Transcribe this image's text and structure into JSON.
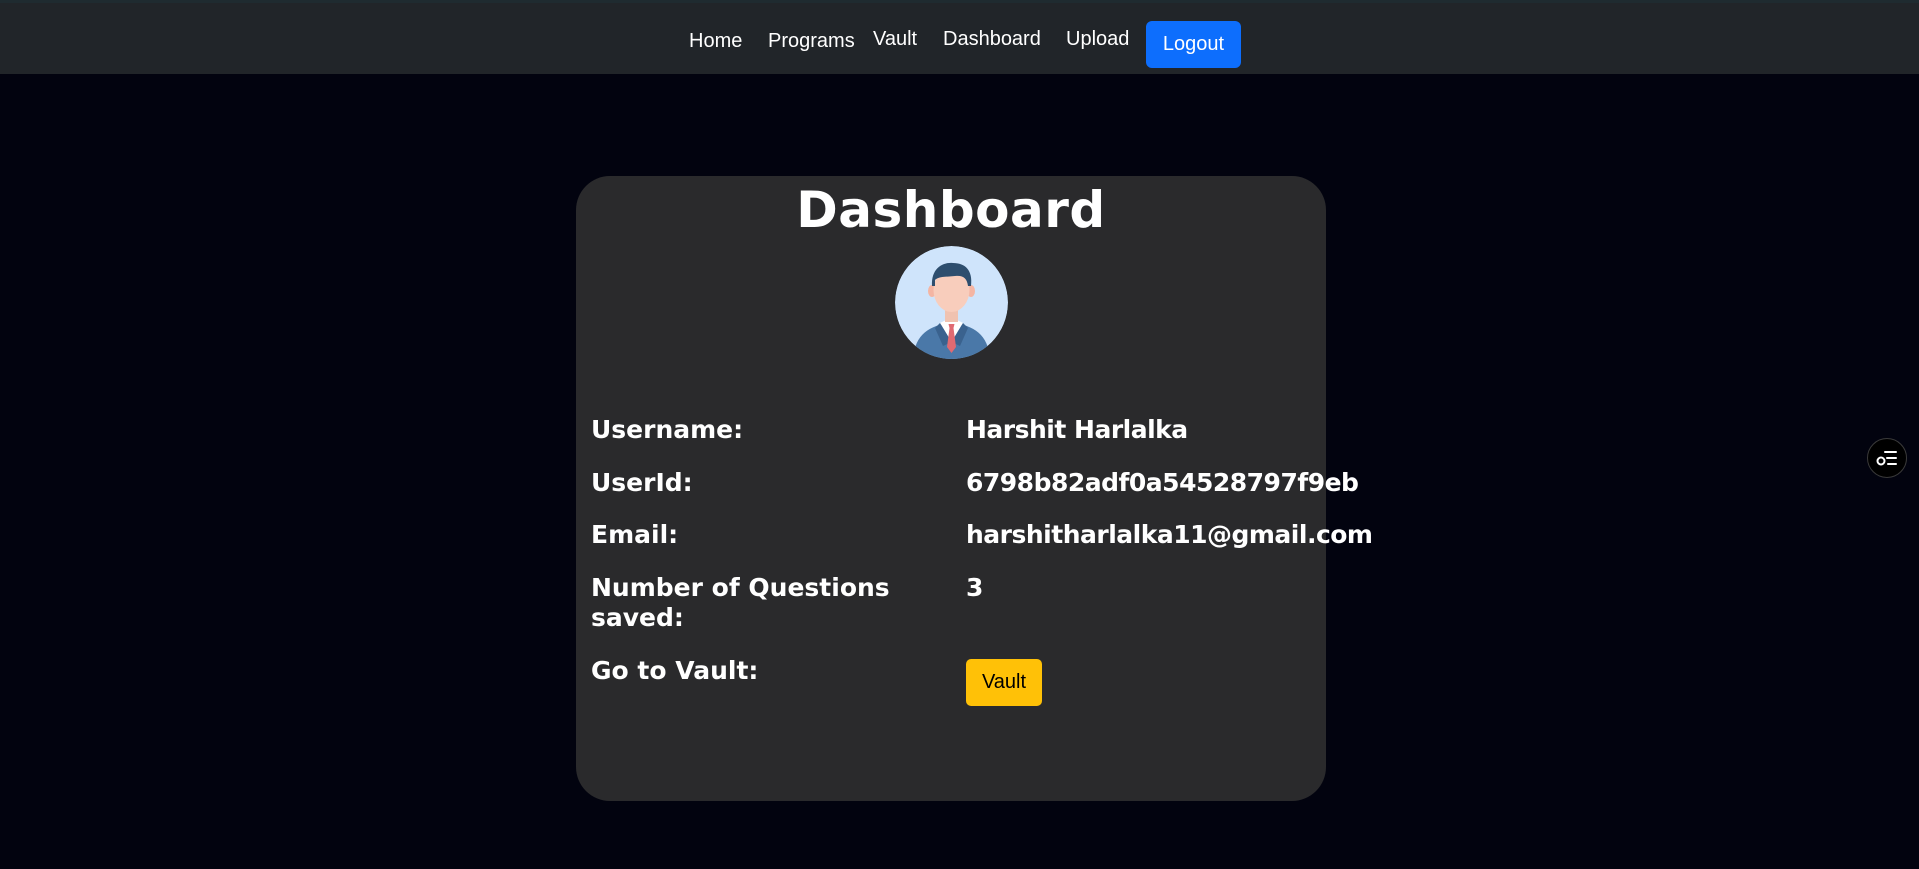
{
  "nav": {
    "home": "Home",
    "programs": "Programs",
    "vault": "Vault",
    "dashboard": "Dashboard",
    "upload": "Upload",
    "logout": "Logout"
  },
  "card": {
    "title": "Dashboard",
    "avatar_icon": "user-avatar-businessman-icon",
    "rows": [
      {
        "label": "Username:",
        "value": "Harshit Harlalka"
      },
      {
        "label": "UserId:",
        "value": "6798b82adf0a54528797f9eb"
      },
      {
        "label": "Email:",
        "value": "harshitharlalka11@gmail.com"
      },
      {
        "label": "Number of Questions saved:",
        "value": "3"
      },
      {
        "label": "Go to Vault:"
      }
    ],
    "vault_button": "Vault"
  },
  "side_widget_icon": "filter-list-icon",
  "colors": {
    "page_bg": "#02030f",
    "navbar_bg": "#212529",
    "card_bg": "#2a2a2c",
    "logout_button": "#0d6efd",
    "vault_button": "#ffc107"
  }
}
